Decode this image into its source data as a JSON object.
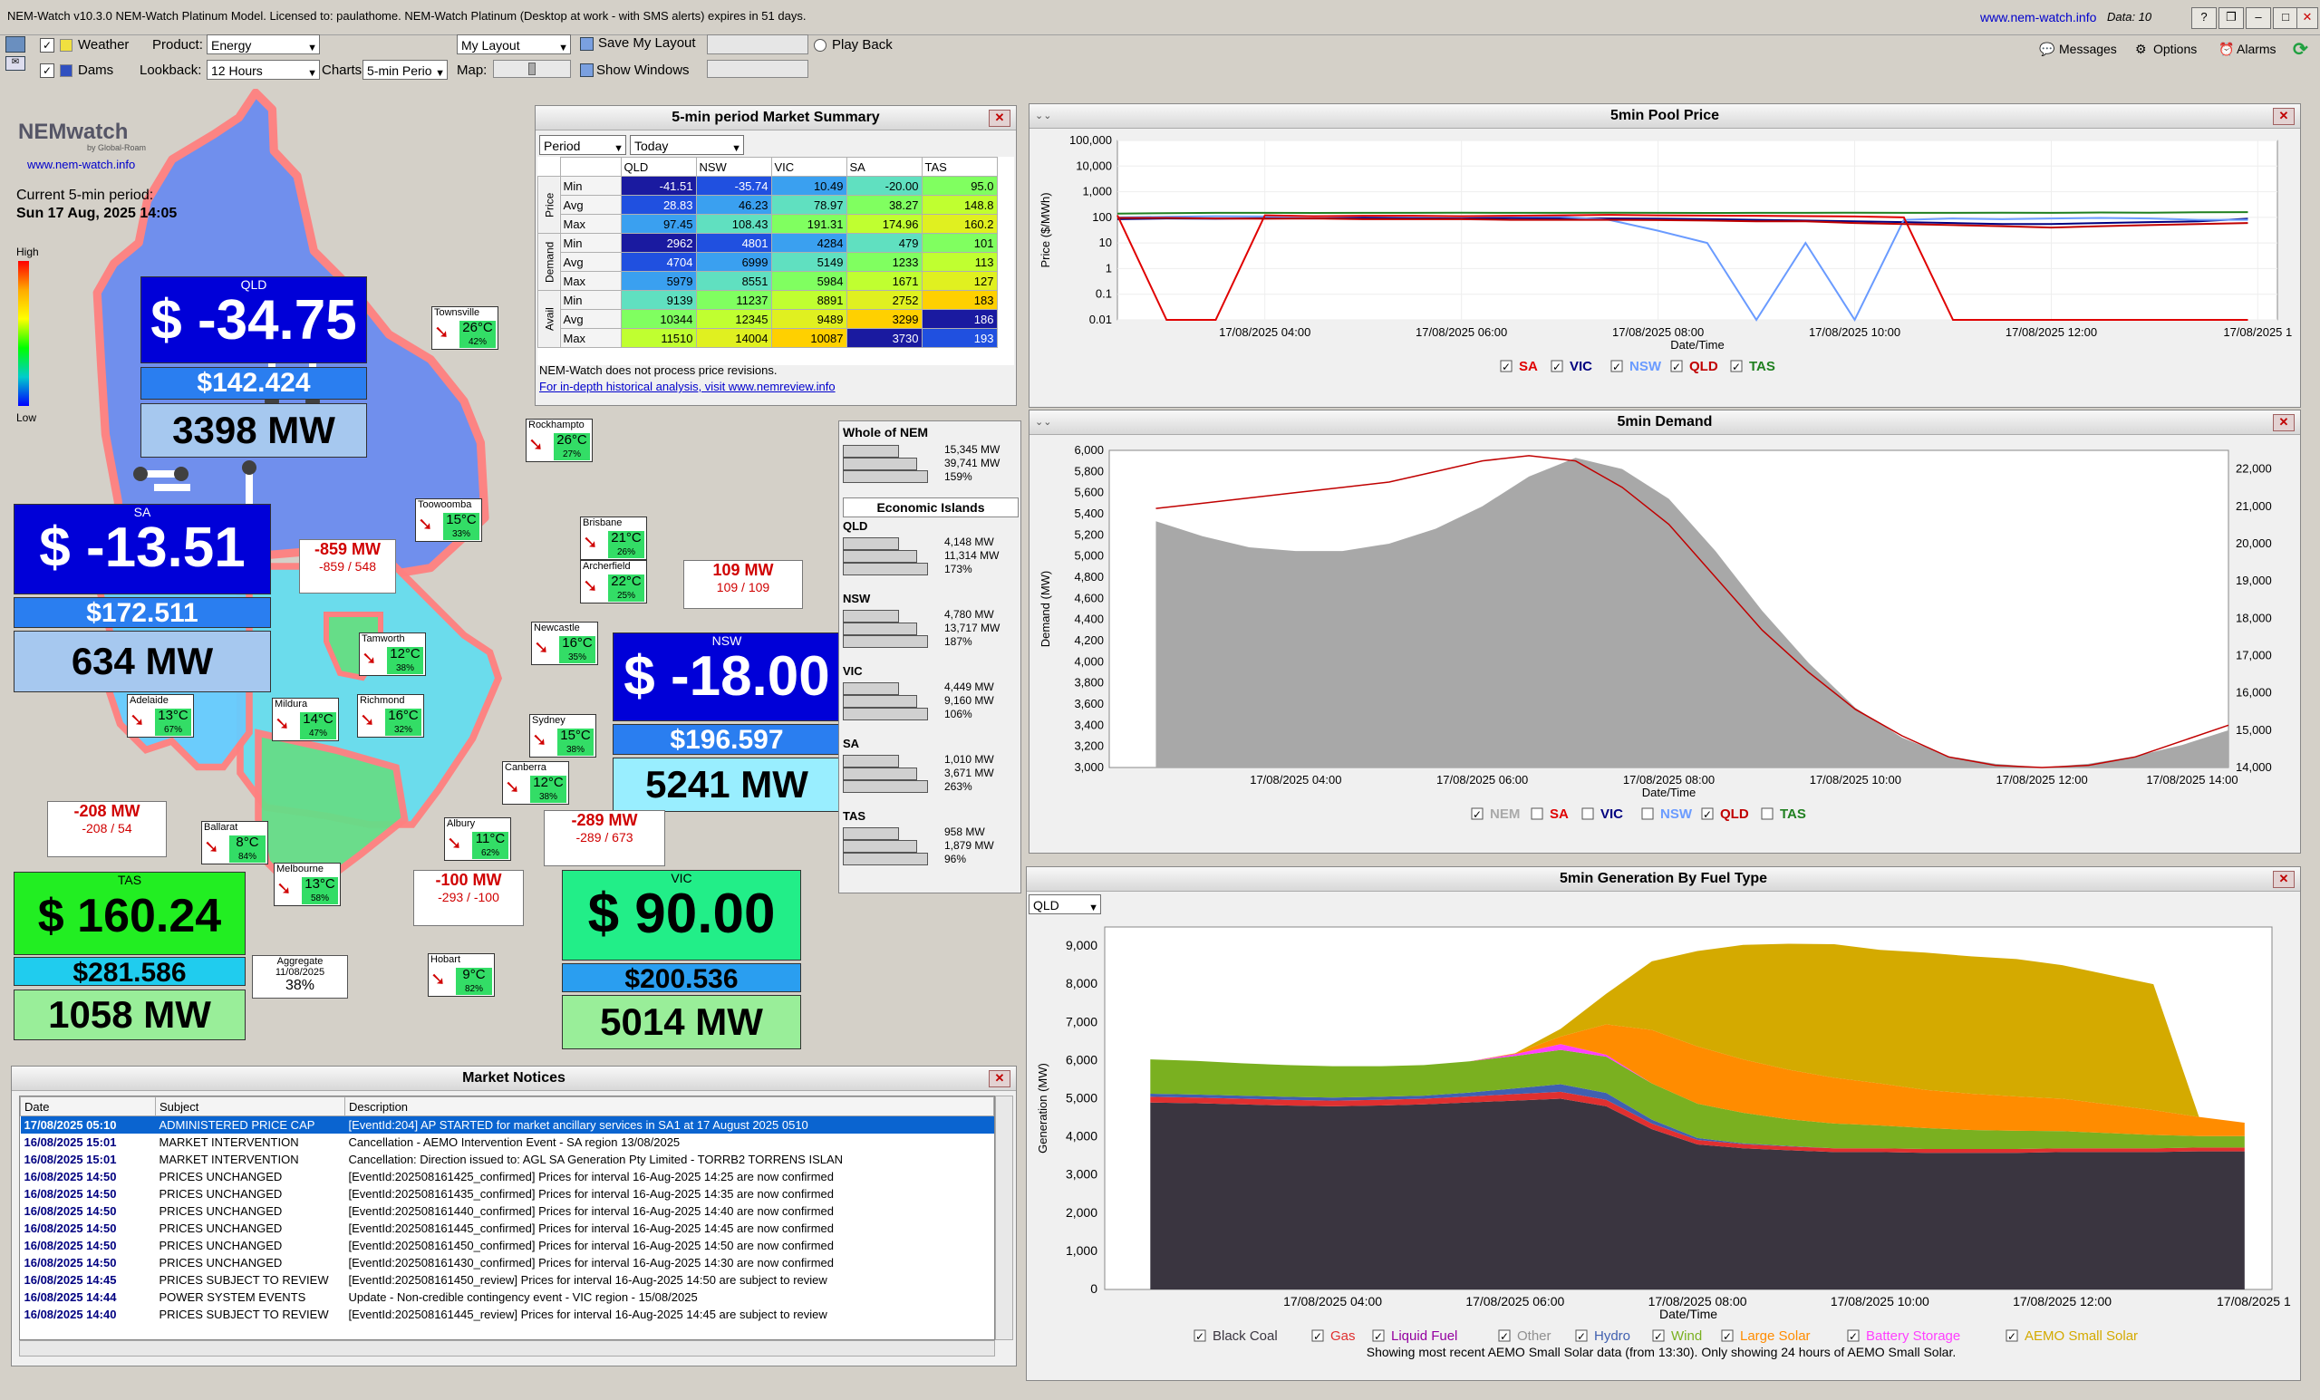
{
  "window": {
    "title": "NEM-Watch v10.3.0 NEM-Watch Platinum Model.    Licensed to: paulathome.   NEM-Watch Platinum (Desktop at work - with SMS alerts) expires in 51 days.",
    "site": "www.nem-watch.info",
    "data_label": "Data: 10"
  },
  "toolbar": {
    "weather": "Weather",
    "dams": "Dams",
    "product_label": "Product:",
    "product_value": "Energy",
    "lookback_label": "Lookback:",
    "lookback_value": "12 Hours",
    "charts_label": "Charts:",
    "charts_value": "5-min Perio",
    "layout_value": "My Layout",
    "save_layout": "Save My Layout",
    "show_windows": "Show Windows",
    "map_label": "Map:",
    "play_back": "Play Back",
    "messages": "Messages",
    "options": "Options",
    "alarms": "Alarms"
  },
  "map": {
    "logo": "NEMwatch",
    "logo_sub": "by Global-Roam",
    "logo_url": "www.nem-watch.info",
    "period_label": "Current 5-min period:",
    "period_value": "Sun 17 Aug, 2025 14:05",
    "scale_high": "High",
    "scale_low": "Low",
    "regions": {
      "qld": {
        "name": "QLD",
        "price": "$ -34.75",
        "avg": "$142.424",
        "mw": "3398 MW",
        "color": "#0000d8"
      },
      "sa": {
        "name": "SA",
        "price": "$ -13.51",
        "avg": "$172.511",
        "mw": "634 MW",
        "color": "#0000d8"
      },
      "nsw": {
        "name": "NSW",
        "price": "$ -18.00",
        "avg": "$196.597",
        "mw": "5241 MW",
        "color": "#0000d8"
      },
      "tas": {
        "name": "TAS",
        "price": "$ 160.24",
        "avg": "$281.586",
        "mw": "1058 MW",
        "color": "#22ee22"
      },
      "vic": {
        "name": "VIC",
        "price": "$ 90.00",
        "avg": "$200.536",
        "mw": "5014 MW",
        "color": "#22ee88"
      }
    },
    "flows": [
      {
        "v": "-859 MW",
        "l": "-859 / 548"
      },
      {
        "v": "109 MW",
        "l": "109 / 109"
      },
      {
        "v": "-208 MW",
        "l": "-208 / 54"
      },
      {
        "v": "-289 MW",
        "l": "-289 / 673"
      },
      {
        "v": "-100 MW",
        "l": "-293 / -100"
      }
    ],
    "weather": [
      {
        "name": "Townsville",
        "temp": "26°C",
        "hum": "42%"
      },
      {
        "name": "Rockhampto",
        "temp": "26°C",
        "hum": "27%"
      },
      {
        "name": "Toowoomba",
        "temp": "15°C",
        "hum": "33%"
      },
      {
        "name": "Brisbane",
        "temp": "21°C",
        "hum": "26%"
      },
      {
        "name": "Archerfield",
        "temp": "22°C",
        "hum": "25%"
      },
      {
        "name": "Tamworth",
        "temp": "12°C",
        "hum": "38%"
      },
      {
        "name": "Newcastle",
        "temp": "16°C",
        "hum": "35%"
      },
      {
        "name": "Richmond",
        "temp": "16°C",
        "hum": "32%"
      },
      {
        "name": "Sydney",
        "temp": "15°C",
        "hum": "38%"
      },
      {
        "name": "Canberra",
        "temp": "12°C",
        "hum": "38%"
      },
      {
        "name": "Mildura",
        "temp": "14°C",
        "hum": "47%"
      },
      {
        "name": "Adelaide",
        "temp": "13°C",
        "hum": "67%"
      },
      {
        "name": "Ballarat",
        "temp": "8°C",
        "hum": "84%"
      },
      {
        "name": "Albury",
        "temp": "11°C",
        "hum": "62%"
      },
      {
        "name": "Melbourne",
        "temp": "13°C",
        "hum": "58%"
      },
      {
        "name": "Hobart",
        "temp": "9°C",
        "hum": "82%"
      }
    ],
    "aggregate": {
      "label": "Aggregate",
      "date": "11/08/2025",
      "value": "38%"
    }
  },
  "summary": {
    "title": "5-min period Market Summary",
    "period": "Period",
    "today": "Today",
    "cols": [
      "QLD",
      "NSW",
      "VIC",
      "SA",
      "TAS"
    ],
    "groups": [
      "Price",
      "Demand",
      "Avail"
    ],
    "rows": [
      {
        "k": "Min",
        "v": [
          "-41.51",
          "-35.74",
          "10.49",
          "-20.00",
          "95.0"
        ]
      },
      {
        "k": "Avg",
        "v": [
          "28.83",
          "46.23",
          "78.97",
          "38.27",
          "148.8"
        ]
      },
      {
        "k": "Max",
        "v": [
          "97.45",
          "108.43",
          "191.31",
          "174.96",
          "160.2"
        ]
      },
      {
        "k": "Min",
        "v": [
          "2962",
          "4801",
          "4284",
          "479",
          "101"
        ]
      },
      {
        "k": "Avg",
        "v": [
          "4704",
          "6999",
          "5149",
          "1233",
          "113"
        ]
      },
      {
        "k": "Max",
        "v": [
          "5979",
          "8551",
          "5984",
          "1671",
          "127"
        ]
      },
      {
        "k": "Min",
        "v": [
          "9139",
          "11237",
          "8891",
          "2752",
          "183"
        ]
      },
      {
        "k": "Avg",
        "v": [
          "10344",
          "12345",
          "9489",
          "3299",
          "186"
        ]
      },
      {
        "k": "Max",
        "v": [
          "11510",
          "14004",
          "10087",
          "3730",
          "193"
        ]
      }
    ],
    "note": "NEM-Watch does not process price revisions.",
    "link": "For in-depth historical analysis, visit www.nemreview.info"
  },
  "islands": {
    "whole_title": "Whole of NEM",
    "whole": [
      "15,345 MW",
      "39,741 MW",
      "159%"
    ],
    "econ_title": "Economic Islands",
    "regions": [
      {
        "n": "QLD",
        "v": [
          "4,148 MW",
          "11,314 MW",
          "173%"
        ]
      },
      {
        "n": "NSW",
        "v": [
          "4,780 MW",
          "13,717 MW",
          "187%"
        ]
      },
      {
        "n": "VIC",
        "v": [
          "4,449 MW",
          "9,160 MW",
          "106%"
        ]
      },
      {
        "n": "SA",
        "v": [
          "1,010 MW",
          "3,671 MW",
          "263%"
        ]
      },
      {
        "n": "TAS",
        "v": [
          "958 MW",
          "1,879 MW",
          "96%"
        ]
      }
    ]
  },
  "notices": {
    "title": "Market Notices",
    "headers": [
      "Date",
      "Subject",
      "Description"
    ],
    "rows": [
      {
        "d": "17/08/2025 05:10",
        "s": "ADMINISTERED PRICE CAP",
        "t": "[EventId:204] AP STARTED for market ancillary services in SA1 at 17 August 2025 0510"
      },
      {
        "d": "16/08/2025 15:01",
        "s": "MARKET INTERVENTION",
        "t": "Cancellation - AEMO Intervention Event - SA region 13/08/2025"
      },
      {
        "d": "16/08/2025 15:01",
        "s": "MARKET INTERVENTION",
        "t": "Cancellation: Direction issued to:  AGL SA Generation Pty Limited - TORRB2 TORRENS ISLAN"
      },
      {
        "d": "16/08/2025 14:50",
        "s": "PRICES UNCHANGED",
        "t": "[EventId:202508161425_confirmed] Prices for interval 16-Aug-2025 14:25 are now confirmed"
      },
      {
        "d": "16/08/2025 14:50",
        "s": "PRICES UNCHANGED",
        "t": "[EventId:202508161435_confirmed] Prices for interval 16-Aug-2025 14:35 are now confirmed"
      },
      {
        "d": "16/08/2025 14:50",
        "s": "PRICES UNCHANGED",
        "t": "[EventId:202508161440_confirmed] Prices for interval 16-Aug-2025 14:40 are now confirmed"
      },
      {
        "d": "16/08/2025 14:50",
        "s": "PRICES UNCHANGED",
        "t": "[EventId:202508161445_confirmed] Prices for interval 16-Aug-2025 14:45 are now confirmed"
      },
      {
        "d": "16/08/2025 14:50",
        "s": "PRICES UNCHANGED",
        "t": "[EventId:202508161450_confirmed] Prices for interval 16-Aug-2025 14:50 are now confirmed"
      },
      {
        "d": "16/08/2025 14:50",
        "s": "PRICES UNCHANGED",
        "t": "[EventId:202508161430_confirmed] Prices for interval 16-Aug-2025 14:30 are now confirmed"
      },
      {
        "d": "16/08/2025 14:45",
        "s": "PRICES SUBJECT TO REVIEW",
        "t": "[EventId:202508161450_review] Prices for interval 16-Aug-2025 14:50 are subject to review"
      },
      {
        "d": "16/08/2025 14:44",
        "s": "POWER SYSTEM EVENTS",
        "t": "Update - Non-credible contingency event - VIC region - 15/08/2025"
      },
      {
        "d": "16/08/2025 14:40",
        "s": "PRICES SUBJECT TO REVIEW",
        "t": "[EventId:202508161445_review] Prices for interval 16-Aug-2025 14:45 are subject to review"
      }
    ]
  },
  "price_panel": {
    "title": "5min Pool Price",
    "ylabel": "Price ($/MWh)",
    "xlabel": "Date/Time",
    "legend": [
      "SA",
      "VIC",
      "NSW",
      "QLD",
      "TAS"
    ]
  },
  "demand_panel": {
    "title": "5min Demand",
    "ylabel": "Demand (MW)",
    "xlabel": "Date/Time",
    "legend": [
      "NEM",
      "SA",
      "VIC",
      "NSW",
      "QLD",
      "TAS"
    ]
  },
  "gen_panel": {
    "title": "5min Generation By Fuel Type",
    "region_select": "QLD",
    "ylabel": "Generation (MW)",
    "xlabel": "Date/Time",
    "legend": [
      "Black Coal",
      "Gas",
      "Liquid Fuel",
      "Other",
      "Hydro",
      "Wind",
      "Large Solar",
      "Battery Storage",
      "AEMO Small Solar"
    ],
    "footnote": "Showing most recent AEMO Small Solar data (from 13:30). Only showing 24 hours of AEMO Small Solar."
  },
  "colors": {
    "SA": "#e00000",
    "VIC": "#000080",
    "NSW": "#6a9bff",
    "QLD": "#c00000",
    "TAS": "#208020",
    "NEM": "#aaaaaa",
    "Black Coal": "#3a3540",
    "Gas": "#e03030",
    "Liquid Fuel": "#9400a0",
    "Other": "#909090",
    "Hydro": "#4060b0",
    "Wind": "#7ab020",
    "Large Solar": "#ff8c00",
    "Battery Storage": "#ff40ff",
    "AEMO Small Solar": "#d4aa00"
  },
  "chart_data": [
    {
      "type": "line",
      "title": "5min Pool Price",
      "xlabel": "Date/Time",
      "ylabel": "Price ($/MWh)",
      "yscale": "log",
      "ylim": [
        0.01,
        100000
      ],
      "yticks": [
        "100,000",
        "10,000",
        "1,000",
        "100",
        "10",
        "1",
        "0.1",
        "0.01"
      ],
      "xticks": [
        "17/08/2025 04:00",
        "17/08/2025 06:00",
        "17/08/2025 08:00",
        "17/08/2025 10:00",
        "17/08/2025 12:00",
        "17/08/2025 1"
      ],
      "x_hours": [
        2.5,
        3,
        3.5,
        4,
        4.5,
        5,
        5.5,
        6,
        6.5,
        7,
        7.5,
        8,
        8.5,
        9,
        9.5,
        10,
        10.5,
        11,
        11.5,
        12,
        12.5,
        13,
        13.5,
        14
      ],
      "series": [
        {
          "name": "TAS",
          "values": [
            140,
            145,
            150,
            150,
            148,
            150,
            150,
            152,
            150,
            150,
            152,
            150,
            148,
            150,
            150,
            152,
            150,
            150,
            152,
            150,
            155,
            152,
            158,
            160
          ]
        },
        {
          "name": "VIC",
          "values": [
            85,
            90,
            88,
            92,
            90,
            95,
            92,
            90,
            95,
            92,
            90,
            88,
            85,
            80,
            75,
            70,
            65,
            60,
            55,
            55,
            60,
            65,
            70,
            88
          ]
        },
        {
          "name": "NSW",
          "values": [
            100,
            105,
            110,
            108,
            110,
            112,
            110,
            110,
            108,
            106,
            80,
            30,
            10,
            0.01,
            10,
            0.01,
            80,
            90,
            85,
            90,
            95,
            90,
            80,
            80
          ]
        },
        {
          "name": "SA",
          "values": [
            120,
            0.01,
            0.01,
            120,
            110,
            115,
            115,
            110,
            115,
            120,
            125,
            120,
            118,
            115,
            112,
            108,
            100,
            0.01,
            0.01,
            0.01,
            0.01,
            0.01,
            0.01,
            0.01
          ]
        },
        {
          "name": "QLD",
          "values": [
            95,
            95,
            90,
            88,
            90,
            85,
            85,
            85,
            80,
            80,
            80,
            78,
            75,
            70,
            70,
            60,
            55,
            50,
            45,
            40,
            45,
            50,
            55,
            60
          ]
        }
      ]
    },
    {
      "type": "area",
      "title": "5min Demand",
      "xlabel": "Date/Time",
      "ylabel": "Demand (MW)",
      "ylim": [
        3000,
        6000
      ],
      "y2lim": [
        14000,
        22500
      ],
      "xticks": [
        "17/08/2025 04:00",
        "17/08/2025 06:00",
        "17/08/2025 08:00",
        "17/08/2025 10:00",
        "17/08/2025 12:00",
        "17/08/2025 14:00"
      ],
      "x_hours": [
        2.5,
        3,
        3.5,
        4,
        4.5,
        5,
        5.5,
        6,
        6.5,
        7,
        7.5,
        8,
        8.5,
        9,
        9.5,
        10,
        10.5,
        11,
        11.5,
        12,
        12.5,
        13,
        13.5,
        14
      ],
      "series": [
        {
          "name": "NEM",
          "axis": "right",
          "values": [
            20600,
            20200,
            19900,
            19800,
            19800,
            20000,
            20400,
            21000,
            21800,
            22300,
            22000,
            21200,
            19800,
            18200,
            16800,
            15600,
            14800,
            14300,
            14100,
            14000,
            14100,
            14300,
            14600,
            15000
          ]
        },
        {
          "name": "QLD",
          "axis": "left",
          "values": [
            5450,
            5500,
            5550,
            5600,
            5650,
            5700,
            5800,
            5900,
            5950,
            5900,
            5650,
            5300,
            4800,
            4300,
            3900,
            3550,
            3300,
            3100,
            3020,
            3000,
            3020,
            3100,
            3250,
            3400
          ]
        }
      ]
    },
    {
      "type": "area",
      "title": "5min Generation By Fuel Type",
      "xlabel": "Date/Time",
      "ylabel": "Generation (MW)",
      "ylim": [
        0,
        9500
      ],
      "yticks": [
        "9,000",
        "8,000",
        "7,000",
        "6,000",
        "5,000",
        "4,000",
        "3,000",
        "2,000",
        "1,000",
        "0"
      ],
      "xticks": [
        "17/08/2025 04:00",
        "17/08/2025 06:00",
        "17/08/2025 08:00",
        "17/08/2025 10:00",
        "17/08/2025 12:00",
        "17/08/2025 1"
      ],
      "x_hours": [
        2,
        2.5,
        3,
        3.5,
        4,
        4.5,
        5,
        5.5,
        6,
        6.5,
        7,
        7.5,
        8,
        8.5,
        9,
        9.5,
        10,
        10.5,
        11,
        11.5,
        12,
        12.5,
        13,
        13.5,
        14
      ],
      "series": [
        {
          "name": "Black Coal",
          "values": [
            4900,
            4880,
            4850,
            4820,
            4800,
            4820,
            4850,
            4900,
            4950,
            5000,
            4800,
            4200,
            3800,
            3700,
            3650,
            3600,
            3600,
            3580,
            3580,
            3580,
            3600,
            3600,
            3600,
            3620,
            3620
          ]
        },
        {
          "name": "Gas",
          "values": [
            150,
            150,
            150,
            150,
            150,
            150,
            150,
            160,
            170,
            180,
            170,
            150,
            120,
            110,
            100,
            100,
            100,
            100,
            100,
            100,
            100,
            100,
            100,
            100,
            100
          ]
        },
        {
          "name": "Hydro",
          "values": [
            80,
            80,
            80,
            80,
            80,
            80,
            80,
            100,
            150,
            200,
            180,
            100,
            50,
            20,
            10,
            0,
            0,
            0,
            0,
            0,
            0,
            0,
            0,
            0,
            0
          ]
        },
        {
          "name": "Wind",
          "values": [
            900,
            880,
            850,
            830,
            820,
            800,
            800,
            820,
            850,
            900,
            950,
            950,
            900,
            800,
            700,
            650,
            600,
            550,
            500,
            480,
            450,
            400,
            350,
            300,
            300
          ]
        },
        {
          "name": "Battery Storage",
          "values": [
            0,
            0,
            0,
            0,
            0,
            0,
            0,
            0,
            50,
            150,
            50,
            0,
            0,
            0,
            0,
            0,
            0,
            0,
            0,
            0,
            0,
            0,
            0,
            0,
            0
          ]
        },
        {
          "name": "Large Solar",
          "values": [
            0,
            0,
            0,
            0,
            0,
            0,
            0,
            0,
            20,
            200,
            800,
            1400,
            1500,
            1400,
            1300,
            1200,
            1100,
            1000,
            950,
            900,
            850,
            750,
            650,
            500,
            350
          ]
        },
        {
          "name": "AEMO Small Solar",
          "values": [
            0,
            0,
            0,
            0,
            0,
            0,
            0,
            0,
            0,
            200,
            800,
            1800,
            2500,
            3000,
            3300,
            3500,
            3500,
            3600,
            3600,
            3600,
            3500,
            3400,
            3300,
            0,
            0
          ]
        }
      ]
    }
  ]
}
